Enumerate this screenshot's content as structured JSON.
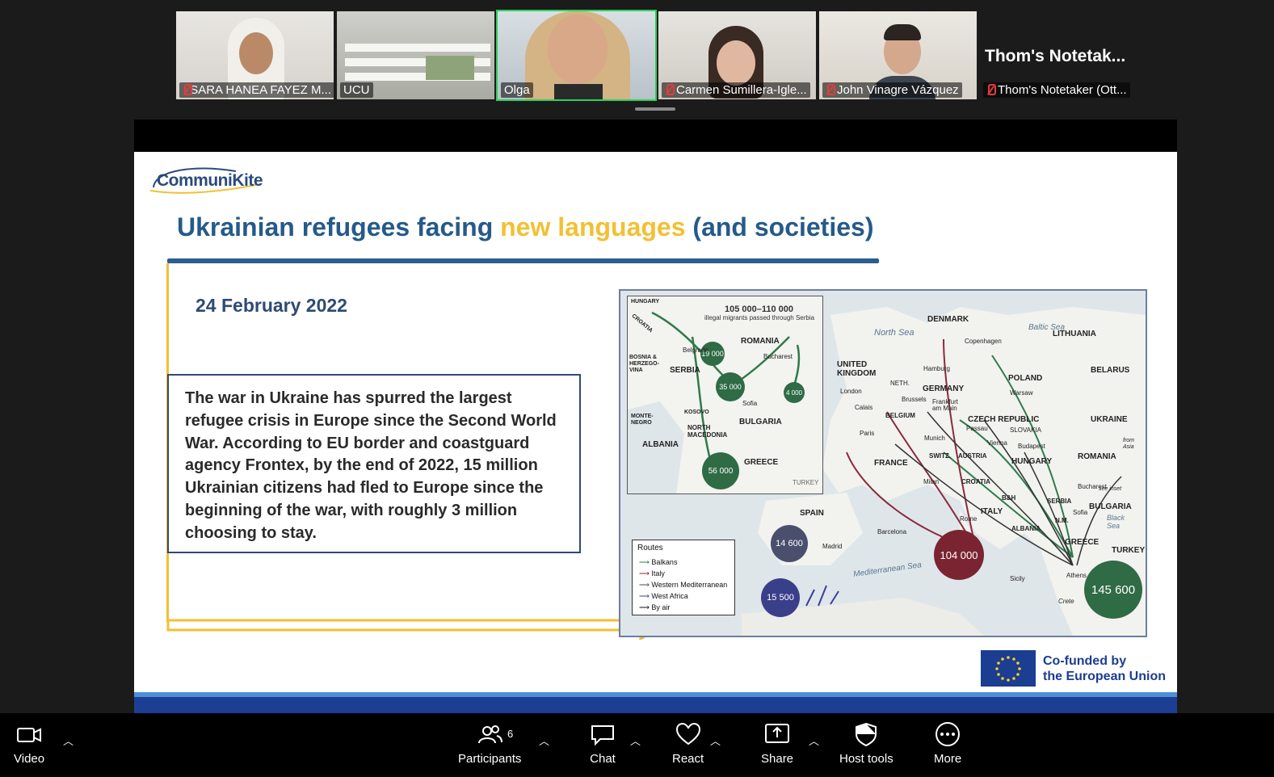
{
  "participants": [
    {
      "name": "SARA HANEA FAYEZ M...",
      "muted": true
    },
    {
      "name": "UCU",
      "muted": false
    },
    {
      "name": "Olga",
      "muted": false,
      "active": true
    },
    {
      "name": "Carmen Sumillera-Igle...",
      "muted": true
    },
    {
      "name": "John Vinagre Vázquez",
      "muted": true
    },
    {
      "name": "Thom's Notetaker (Ott...",
      "muted": true,
      "title": "Thom's  Notetak..."
    }
  ],
  "slide": {
    "logo": "CommuniKite",
    "title_part1": "Ukrainian refugees facing ",
    "title_highlight": "new languages",
    "title_part3": " (and societies)",
    "date": "24 February 2022",
    "body": "The war in Ukraine has spurred the largest refugee crisis in Europe since the Second World War. According to EU border and coastguard agency Frontex, by the end of 2022, 15 million Ukrainian citizens had fled to Europe since the beginning of the war, with roughly 3 million choosing to stay.",
    "eu_line1": "Co-funded by",
    "eu_line2": "the European Union"
  },
  "map": {
    "inset_title": "105 000–110 000",
    "inset_subtitle": "illegal migrants passed through Serbia",
    "bubbles": [
      {
        "label": "19 000",
        "color": "#2f6b45"
      },
      {
        "label": "35 000",
        "color": "#2f6b45"
      },
      {
        "label": "4 000",
        "color": "#2f6b45"
      },
      {
        "label": "56 000",
        "color": "#2f6b45"
      },
      {
        "label": "14 600",
        "color": "#4a4f6e"
      },
      {
        "label": "15 500",
        "color": "#3a3f8a"
      },
      {
        "label": "104 000",
        "color": "#7a2432"
      },
      {
        "label": "145 600",
        "color": "#2f6b45"
      }
    ],
    "countries": [
      "HUNGARY",
      "CROATIA",
      "ROMANIA",
      "BOSNIA & HERZEGO-VINA",
      "SERBIA",
      "Belgrade",
      "Bucharest",
      "MONTE-NEGRO",
      "KOSOVO",
      "Sofia",
      "BULGARIA",
      "NORTH MACEDONIA",
      "ALBANIA",
      "GREECE",
      "TURKEY",
      "North Sea",
      "DENMARK",
      "Copenhagen",
      "Baltic Sea",
      "LITHUANIA",
      "BELARUS",
      "UNITED KINGDOM",
      "London",
      "Calais",
      "NETH.",
      "Hamburg",
      "GERMANY",
      "POLAND",
      "Warsaw",
      "BELGIUM",
      "Brussels",
      "Frankfurt am Main",
      "CZECH REPUBLIC",
      "UKRAINE",
      "Paris",
      "Munich",
      "Passau",
      "SLOVAKIA",
      "Vienna",
      "Budapest",
      "FRANCE",
      "SWITZ.",
      "AUSTRIA",
      "HUNGARY",
      "ROMANIA",
      "Milan",
      "CROATIA",
      "B&H",
      "SERBIA",
      "Bucharest",
      "see inset",
      "BULGARIA",
      "Sofia",
      "SPAIN",
      "Rome",
      "ITALY",
      "Black Sea",
      "Madrid",
      "Barcelona",
      "ALBANIA",
      "N.M.",
      "GREECE",
      "TURKEY",
      "Mediterranean Sea",
      "Sicily",
      "Athens",
      "Crete",
      "from Asia"
    ],
    "legend_title": "Routes",
    "legend": [
      {
        "label": "Balkans",
        "color": "#2f7a4a"
      },
      {
        "label": "Italy",
        "color": "#8a2a3a"
      },
      {
        "label": "Western Mediterranean",
        "color": "#4a4a5a"
      },
      {
        "label": "West Africa",
        "color": "#3a3f9a"
      },
      {
        "label": "By air",
        "color": "#111111"
      }
    ]
  },
  "toolbar": {
    "video": "Video",
    "participants": "Participants",
    "participants_count": "6",
    "chat": "Chat",
    "react": "React",
    "share": "Share",
    "host_tools": "Host tools",
    "more": "More"
  }
}
